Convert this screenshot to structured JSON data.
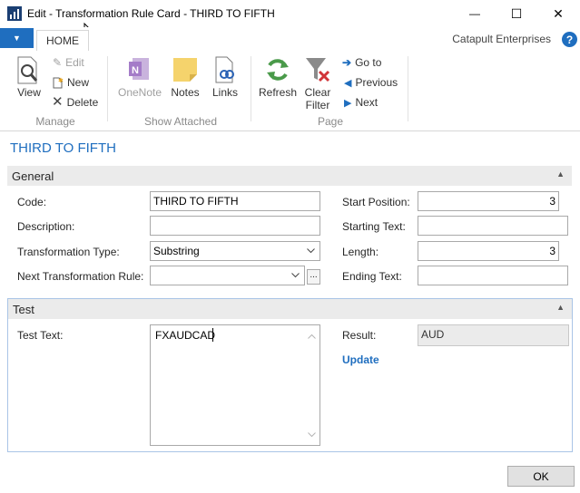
{
  "window": {
    "title": "Edit - Transformation Rule Card - THIRD TO FIFTH",
    "minimize_glyph": "—",
    "maximize_glyph": "☐",
    "close_glyph": "✕"
  },
  "ribbon": {
    "app_menu_glyph": "▼",
    "tab_home": "HOME",
    "company": "Catapult Enterprises",
    "help_glyph": "?",
    "manage": {
      "label": "Manage",
      "view": "View",
      "edit": "Edit",
      "new": "New",
      "delete": "Delete"
    },
    "show_attached": {
      "label": "Show Attached",
      "onenote": "OneNote",
      "notes": "Notes",
      "links": "Links"
    },
    "page": {
      "label": "Page",
      "refresh": "Refresh",
      "clear_filter_line1": "Clear",
      "clear_filter_line2": "Filter",
      "go_to": "Go to",
      "previous": "Previous",
      "next": "Next"
    }
  },
  "page_title": "THIRD TO FIFTH",
  "general": {
    "header": "General",
    "collapse_glyph": "▲",
    "code_label": "Code:",
    "code_value": "THIRD TO FIFTH",
    "description_label": "Description:",
    "description_value": "",
    "transformation_type_label": "Transformation Type:",
    "transformation_type_value": "Substring",
    "next_rule_label": "Next Transformation Rule:",
    "next_rule_value": "",
    "lookup_glyph": "...",
    "start_position_label": "Start Position:",
    "start_position_value": "3",
    "starting_text_label": "Starting Text:",
    "starting_text_value": "",
    "length_label": "Length:",
    "length_value": "3",
    "ending_text_label": "Ending Text:",
    "ending_text_value": ""
  },
  "test": {
    "header": "Test",
    "collapse_glyph": "▲",
    "test_text_label": "Test Text:",
    "test_text_value": "FXAUDCAD",
    "result_label": "Result:",
    "result_value": "AUD",
    "update_link": "Update"
  },
  "ok_button": "OK",
  "colors": {
    "accent": "#1f6ebf",
    "header_bg": "#ebebeb"
  }
}
